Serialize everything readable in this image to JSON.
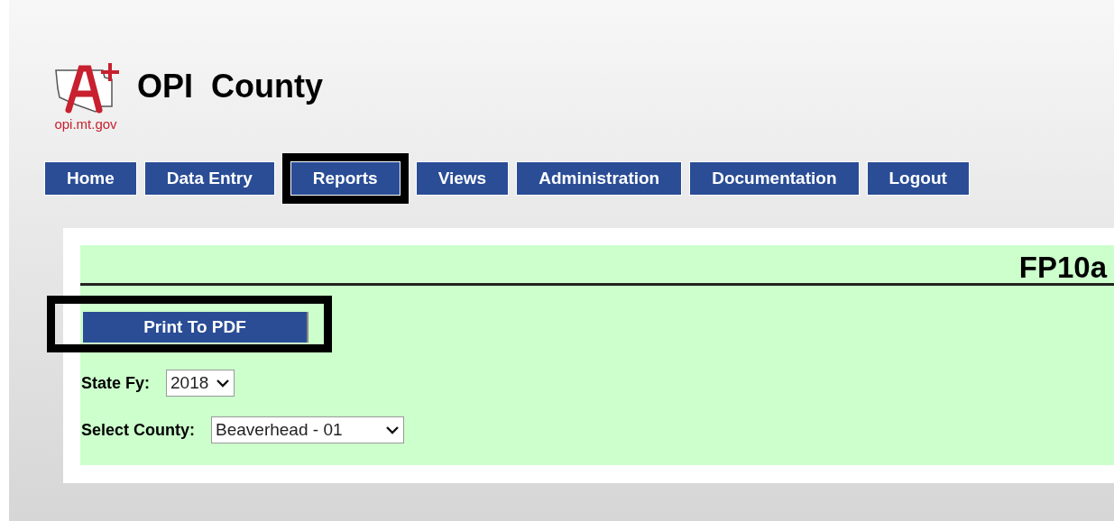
{
  "header": {
    "logo_caption": "opi.mt.gov",
    "title": "OPI  County"
  },
  "nav": [
    {
      "label": "Home",
      "highlighted": false
    },
    {
      "label": "Data Entry",
      "highlighted": false
    },
    {
      "label": "Reports",
      "highlighted": true
    },
    {
      "label": "Views",
      "highlighted": false
    },
    {
      "label": "Administration",
      "highlighted": false
    },
    {
      "label": "Documentation",
      "highlighted": false
    },
    {
      "label": "Logout",
      "highlighted": false
    }
  ],
  "report": {
    "title": "FP10a",
    "print_button": {
      "label": "Print To PDF",
      "highlighted": true
    },
    "fields": [
      {
        "label": "State Fy:",
        "value": "2018"
      },
      {
        "label": "Select County:",
        "value": "Beaverhead - 01"
      }
    ]
  }
}
